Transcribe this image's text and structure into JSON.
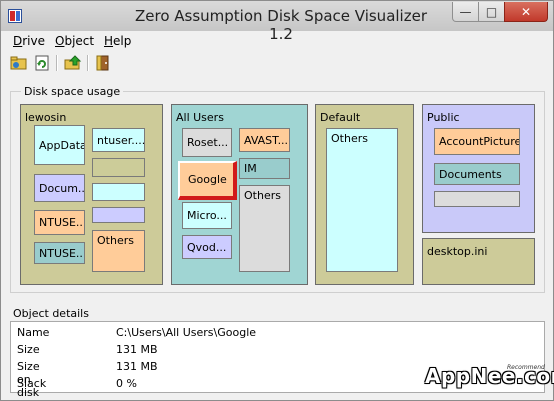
{
  "window": {
    "title": "Zero Assumption Disk Space Visualizer 1.2",
    "min": "—",
    "max": "□",
    "close": "✕"
  },
  "menu": [
    {
      "accel": "D",
      "rest": "rive"
    },
    {
      "accel": "O",
      "rest": "bject"
    },
    {
      "accel": "H",
      "rest": "elp"
    }
  ],
  "toolbar": {
    "icons": [
      "open-folder-icon",
      "refresh-icon",
      "up-folder-icon",
      "exit-door-icon"
    ]
  },
  "disk_usage": {
    "group_label": "Disk space usage",
    "colors": {
      "panel_olive": "#cdcb99",
      "panel_teal": "#a0d5d3",
      "panel_lavender": "#c9c9f9",
      "light_cyan": "#ccffff",
      "lavender": "#ccccff",
      "peach": "#ffcc99",
      "teal": "#99cccc",
      "olive": "#cccc99",
      "gray": "#dcdcdc",
      "selected_border": "#d11a1a"
    },
    "panels": [
      {
        "label": "lewosin",
        "items": [
          "AppData",
          "Docum...",
          "NTUSE...",
          "NTUSE...",
          "ntuser.....",
          "Others"
        ]
      },
      {
        "label": "All Users",
        "items": [
          "Roset...",
          "AVAST...",
          "Google",
          "IM",
          "Others",
          "Micro...",
          "Qvod..."
        ]
      },
      {
        "label": "Default",
        "items": [
          "Others"
        ]
      },
      {
        "label": "Public",
        "items": [
          "AccountPictures",
          "Documents"
        ]
      },
      {
        "label": "desktop.ini",
        "items": []
      }
    ]
  },
  "details": {
    "group_label": "Object details",
    "rows": [
      {
        "label": "Name",
        "value": "C:\\Users\\All Users\\Google"
      },
      {
        "label": "Size",
        "value": "131 MB"
      },
      {
        "label": "Size on disk",
        "value": "131 MB"
      },
      {
        "label": "Slack",
        "value": "0 %"
      }
    ]
  },
  "watermark": {
    "text": "AppNee.com",
    "sub": "Recommend"
  }
}
